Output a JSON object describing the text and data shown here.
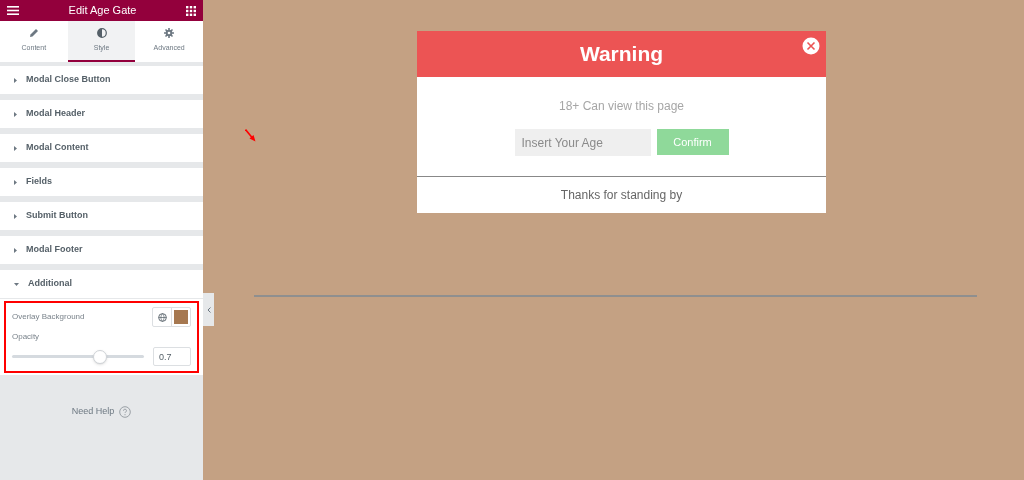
{
  "panel": {
    "title": "Edit Age Gate",
    "tabs": [
      {
        "label": "Content",
        "selected": false
      },
      {
        "label": "Style",
        "selected": true
      },
      {
        "label": "Advanced",
        "selected": false
      }
    ],
    "sections": [
      {
        "label": "Modal Close Button",
        "expanded": false
      },
      {
        "label": "Modal Header",
        "expanded": false
      },
      {
        "label": "Modal Content",
        "expanded": false
      },
      {
        "label": "Fields",
        "expanded": false
      },
      {
        "label": "Submit Button",
        "expanded": false
      },
      {
        "label": "Modal Footer",
        "expanded": false
      },
      {
        "label": "Additional",
        "expanded": true
      }
    ],
    "overlay_background": {
      "label": "Overlay Background",
      "color": "#a67850"
    },
    "opacity": {
      "label": "Opacity",
      "level": 0.67,
      "value": "0.7"
    },
    "help": "Need Help"
  },
  "modal": {
    "title": "Warning",
    "message": "18+ Can view this page",
    "age_field": {
      "placeholder": "Insert Your Age"
    },
    "button": "Confirm",
    "footer": "Thanks for standing by"
  }
}
